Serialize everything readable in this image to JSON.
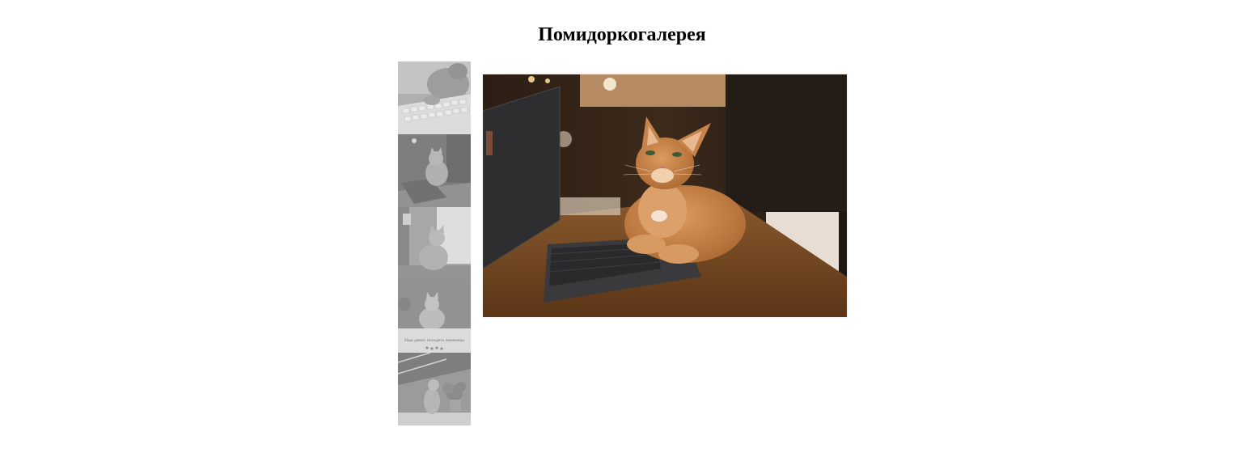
{
  "page": {
    "title": "Помидоркогалерея"
  },
  "thumbnails": [
    {
      "name": "thumb-cat-keyboard",
      "caption": ""
    },
    {
      "name": "thumb-cat-desk-laptop",
      "caption": ""
    },
    {
      "name": "thumb-cat-window",
      "caption": ""
    },
    {
      "name": "thumb-cat-sign",
      "caption": "Наш девиз: посидеть немножко"
    },
    {
      "name": "thumb-cat-stairs-plant",
      "caption": ""
    }
  ],
  "main_image": {
    "subject": "ginger-cat-next-to-laptop"
  },
  "colors": {
    "background": "#ffffff",
    "title": "#000000",
    "cat_fur": "#c9864a",
    "wood_table": "#7a4a22",
    "laptop": "#2a2a2c"
  }
}
